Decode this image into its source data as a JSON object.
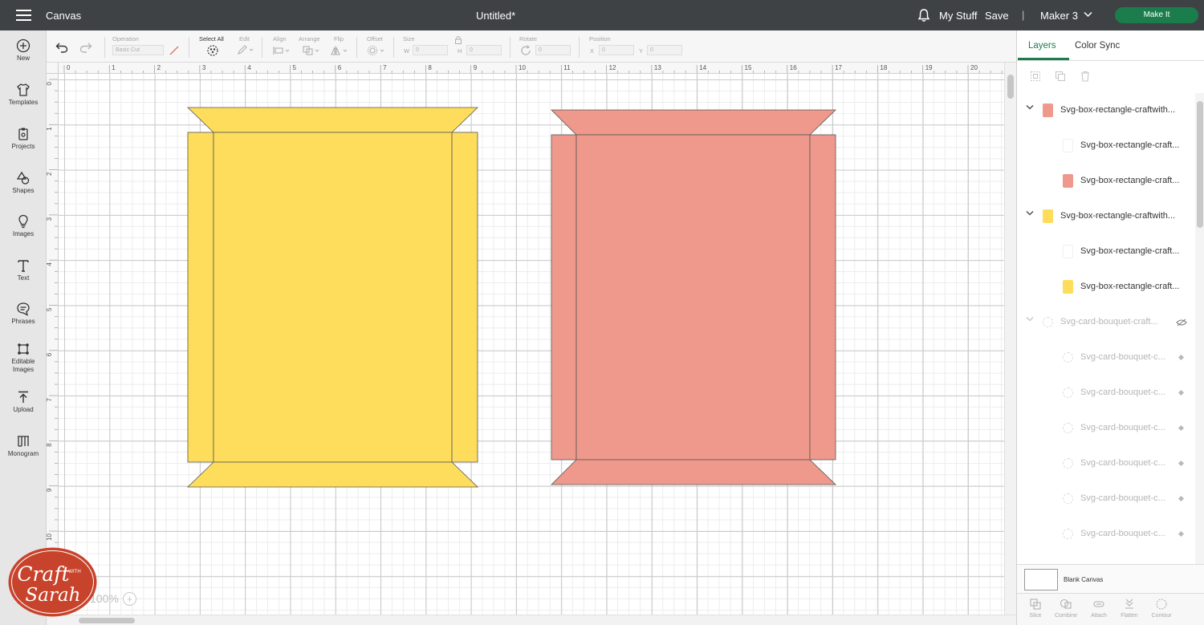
{
  "topbar": {
    "app_title": "Canvas",
    "document_title": "Untitled*",
    "my_stuff": "My Stuff",
    "save": "Save",
    "separator": "|",
    "machine": "Maker 3",
    "make_it": "Make It"
  },
  "left_tools": [
    {
      "label": "New",
      "icon": "plus-circle-icon"
    },
    {
      "label": "Templates",
      "icon": "shirt-icon"
    },
    {
      "label": "Projects",
      "icon": "clipboard-icon"
    },
    {
      "label": "Shapes",
      "icon": "shapes-icon"
    },
    {
      "label": "Images",
      "icon": "lightbulb-icon"
    },
    {
      "label": "Text",
      "icon": "text-icon"
    },
    {
      "label": "Phrases",
      "icon": "speech-bubble-icon"
    },
    {
      "label": "Editable\nImages",
      "icon": "editable-image-icon"
    },
    {
      "label": "Upload",
      "icon": "upload-icon"
    },
    {
      "label": "Monogram",
      "icon": "monogram-icon"
    }
  ],
  "edit_toolbar": {
    "operation_label": "Operation",
    "operation_value": "Basic Cut",
    "select_all": "Select All",
    "edit": "Edit",
    "align": "Align",
    "arrange": "Arrange",
    "flip": "Flip",
    "offset": "Offset",
    "size": "Size",
    "w": "W",
    "h": "H",
    "w_value": "0",
    "h_value": "0",
    "rotate": "Rotate",
    "rotate_value": "0",
    "position": "Position",
    "x": "X",
    "y": "Y",
    "x_value": "0",
    "y_value": "0"
  },
  "rulers": {
    "horizontal": [
      "0",
      "1",
      "2",
      "3",
      "4",
      "5",
      "6",
      "7",
      "8",
      "9",
      "10",
      "11",
      "12",
      "13",
      "14",
      "15",
      "16",
      "17",
      "18",
      "19",
      "20"
    ],
    "vertical": [
      "0",
      "1",
      "2",
      "3",
      "4",
      "5",
      "6",
      "7",
      "8",
      "9",
      "10"
    ]
  },
  "zoom": "100%",
  "zoom_plus": "+",
  "logo": {
    "text_line1": "Craft",
    "text_with": "WITH",
    "text_line2": "Sarah",
    "color": "#c8432b"
  },
  "shapes": [
    {
      "name": "yellow-box",
      "color": "#fedd5c"
    },
    {
      "name": "pink-box",
      "color": "#ee998b"
    }
  ],
  "right_panel": {
    "tab_layers": "Layers",
    "tab_color_sync": "Color Sync",
    "layers": [
      {
        "type": "group",
        "name": "Svg-box-rectangle-craftwith...",
        "swatch": "#ee998b",
        "dim": false
      },
      {
        "type": "child",
        "name": "Svg-box-rectangle-craft...",
        "swatch": "#ffffff",
        "dim": false
      },
      {
        "type": "child",
        "name": "Svg-box-rectangle-craft...",
        "swatch": "#ee998b",
        "dim": false
      },
      {
        "type": "group",
        "name": "Svg-box-rectangle-craftwith...",
        "swatch": "#fedd5c",
        "dim": false
      },
      {
        "type": "child",
        "name": "Svg-box-rectangle-craft...",
        "swatch": "#ffffff",
        "dim": false
      },
      {
        "type": "child",
        "name": "Svg-box-rectangle-craft...",
        "swatch": "#fedd5c",
        "dim": false
      },
      {
        "type": "group",
        "name": "Svg-card-bouquet-craft...",
        "swatch": "",
        "dim": true,
        "hidden": true
      },
      {
        "type": "child",
        "name": "Svg-card-bouquet-c...",
        "swatch": "",
        "dim": true
      },
      {
        "type": "child",
        "name": "Svg-card-bouquet-c...",
        "swatch": "",
        "dim": true
      },
      {
        "type": "child",
        "name": "Svg-card-bouquet-c...",
        "swatch": "",
        "dim": true
      },
      {
        "type": "child",
        "name": "Svg-card-bouquet-c...",
        "swatch": "",
        "dim": true
      },
      {
        "type": "child",
        "name": "Svg-card-bouquet-c...",
        "swatch": "",
        "dim": true
      },
      {
        "type": "child",
        "name": "Svg-card-bouquet-c...",
        "swatch": "",
        "dim": true
      }
    ],
    "blank_canvas": "Blank Canvas",
    "bottom_actions": [
      {
        "label": "Slice",
        "icon": "slice-icon"
      },
      {
        "label": "Combine",
        "icon": "combine-icon"
      },
      {
        "label": "Attach",
        "icon": "attach-icon"
      },
      {
        "label": "Flatten",
        "icon": "flatten-icon"
      },
      {
        "label": "Contour",
        "icon": "contour-icon"
      }
    ]
  },
  "colors": {
    "topbar": "#3f4245",
    "accent_green": "#1b7d4c",
    "yellow": "#fedd5c",
    "pink": "#ee998b"
  }
}
